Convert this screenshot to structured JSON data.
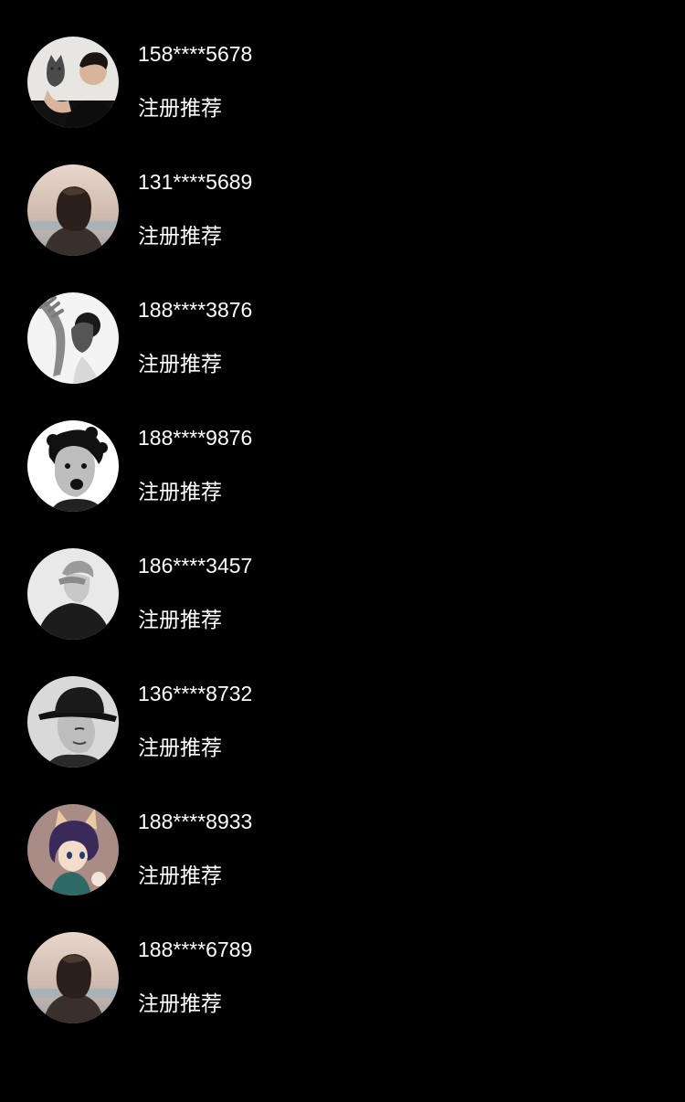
{
  "colors": {
    "background": "#000000",
    "text": "#ffffff"
  },
  "referrals": [
    {
      "phone": "158****5678",
      "tag": "注册推荐",
      "avatar": "man-with-kitten"
    },
    {
      "phone": "131****5689",
      "tag": "注册推荐",
      "avatar": "back-view-person-seaside"
    },
    {
      "phone": "188****3876",
      "tag": "注册推荐",
      "avatar": "hand-over-face-bw"
    },
    {
      "phone": "188****9876",
      "tag": "注册推荐",
      "avatar": "curly-hair-man-bw"
    },
    {
      "phone": "186****3457",
      "tag": "注册推荐",
      "avatar": "man-covering-eyes-bw"
    },
    {
      "phone": "136****8732",
      "tag": "注册推荐",
      "avatar": "man-in-hat-bw"
    },
    {
      "phone": "188****8933",
      "tag": "注册推荐",
      "avatar": "anime-catboy"
    },
    {
      "phone": "188****6789",
      "tag": "注册推荐",
      "avatar": "back-view-person-seaside"
    }
  ]
}
